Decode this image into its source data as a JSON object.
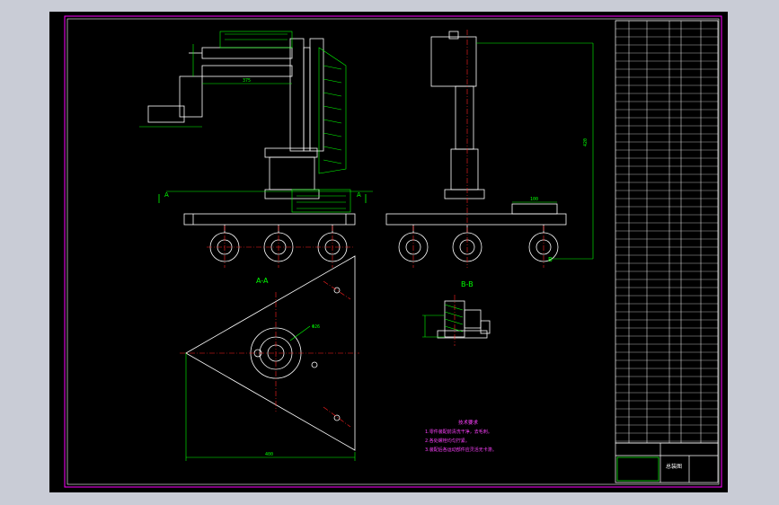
{
  "colors": {
    "background": "#c9ccd6",
    "canvas": "#000000",
    "border": "#ff00ff",
    "geometry": "#ffffff",
    "dimension": "#00ff00",
    "centerline": "#ff2020",
    "notes": "#ff40ff",
    "table": "#ffffff"
  },
  "views": {
    "section_aa": "A-A",
    "section_bb": "B-B",
    "cut_mark_a": "A",
    "cut_mark_b": "B"
  },
  "dimensions": {
    "front_width": "375",
    "side_height": "420",
    "side_width": "100",
    "plate_width": "400",
    "hole_dia": "Φ26",
    "side_offset": "110"
  },
  "notes": {
    "title": "技术要求",
    "lines": [
      "1.零件装配前清洗干净，去毛刺。",
      "2.各处螺栓均匀拧紧。",
      "3.装配后各运动部件应灵活无卡滞。"
    ]
  },
  "title_block": {
    "drawing_no": "总装图"
  }
}
